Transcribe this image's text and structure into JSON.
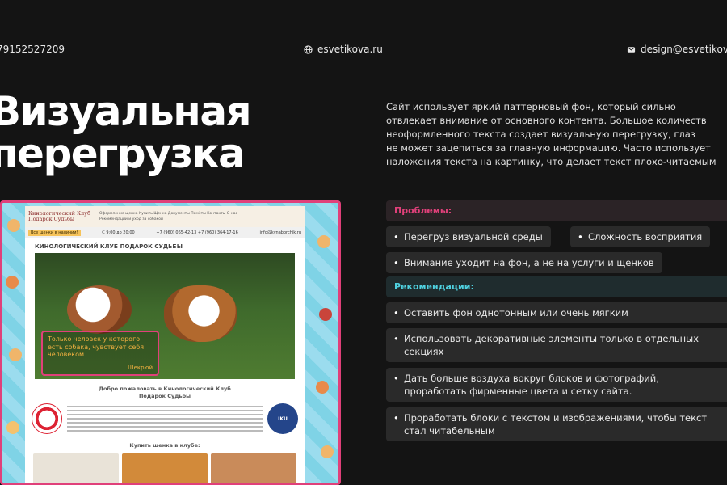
{
  "contacts": {
    "phone": "79152527209",
    "site": "esvetikova.ru",
    "email": "design@esvetikov"
  },
  "title": {
    "line1": "Визуальная",
    "line2": "перегрузка"
  },
  "description": {
    "line1": "Сайт использует яркий паттерновый фон, который сильно",
    "line2": "отвлекает внимание от основного контента. Большое количеств",
    "line3": "неоформленного текста создает визуальную перегрузку, глаз",
    "line4": "не может зацепиться за главную информацию. Часто использует",
    "line5": "наложения текста на картинку, что делает текст плохо-читаемым"
  },
  "screenshot": {
    "logo_line1": "Кинологический Клуб",
    "logo_line2": "Подарок Судьбы",
    "nav_line1": "Оформление щенка   Купить Щенка   Документы   Помёты   Контакты   О нас",
    "nav_line2": "Рекомендации и уход за собакой",
    "hours": "С 9:00 до 20:00",
    "phone1": "+7 (960) 065-42-13",
    "phone2": "+7 (960) 364-17-16",
    "email": "info@kynaborchik.ru",
    "announce": "Все щенки в наличии!",
    "heading": "КИНОЛОГИЧЕСКИЙ КЛУБ ПОДАРОК СУДЬБЫ",
    "quote_line1": "Только человек у которого",
    "quote_line2": "есть собака, чувствует себя",
    "quote_line3": "человеком",
    "quote_author": "Шекрюй",
    "welcome_line1": "Добро пожаловать в Кинологический Клуб",
    "welcome_line2": "Подарок Судьбы",
    "iku": "IKU",
    "buy": "Купить щенка в клубе:"
  },
  "problems": {
    "label": "Проблемы:",
    "items": [
      "Перегруз визуальной среды",
      "Сложность восприятия",
      "Внимание уходит на фон, а не на услуги и щенков"
    ]
  },
  "recommendations": {
    "label": "Рекомендации:",
    "item1": "Оставить фон однотонным или очень мягким",
    "item2_line1": "Использовать декоративные элементы только в отдельных",
    "item2_line2": "секциях",
    "item3_line1": "Дать больше воздуха вокруг блоков и фотографий,",
    "item3_line2": "проработать фирменные цвета и сетку сайта.",
    "item4_line1": "Проработать блоки с текстом и изображениями, чтобы текст",
    "item4_line2": "стал читабельным"
  },
  "colors": {
    "accent_pink": "#e0407a",
    "accent_cyan": "#4fd1e0",
    "background": "#141414"
  }
}
